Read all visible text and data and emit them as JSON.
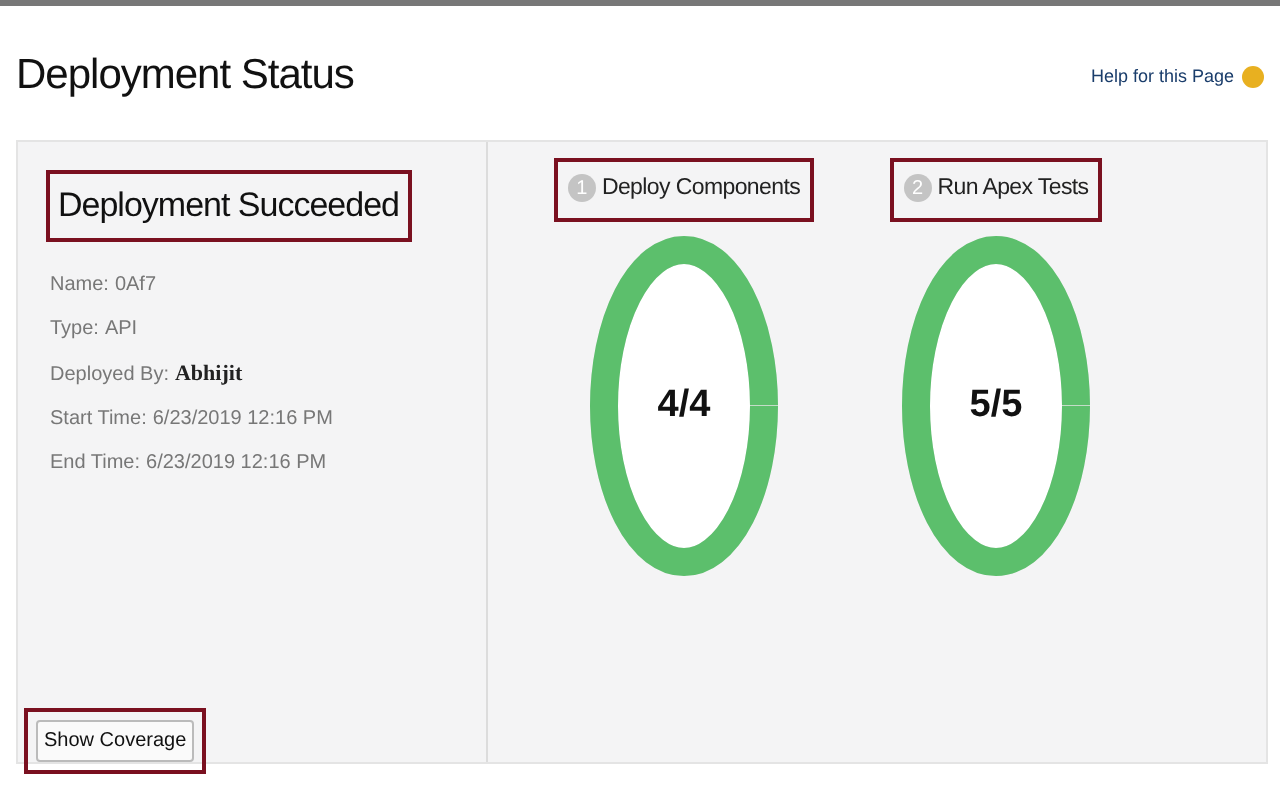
{
  "page_title": "Deployment Status",
  "help_link": "Help for this Page",
  "summary": {
    "heading": "Deployment Succeeded",
    "highlighted": true,
    "details": [
      {
        "label": "Name:",
        "value": "0Af7",
        "kind": "text"
      },
      {
        "label": "Type:",
        "value": "API",
        "kind": "text"
      },
      {
        "label": "Deployed By:",
        "value": "Abhijit",
        "kind": "user"
      },
      {
        "label": "Start Time:",
        "value": "6/23/2019 12:16 PM",
        "kind": "text"
      },
      {
        "label": "End Time:",
        "value": "6/23/2019 12:16 PM",
        "kind": "text"
      }
    ],
    "button": {
      "label": "Show Coverage",
      "highlighted": true
    }
  },
  "steps": [
    {
      "number": "1",
      "label": "Deploy Components",
      "highlighted": true,
      "count": "4/4",
      "level": 1
    },
    {
      "number": "2",
      "label": "Run Apex Tests",
      "highlighted": true,
      "count": "5/5",
      "level": 1
    }
  ]
}
